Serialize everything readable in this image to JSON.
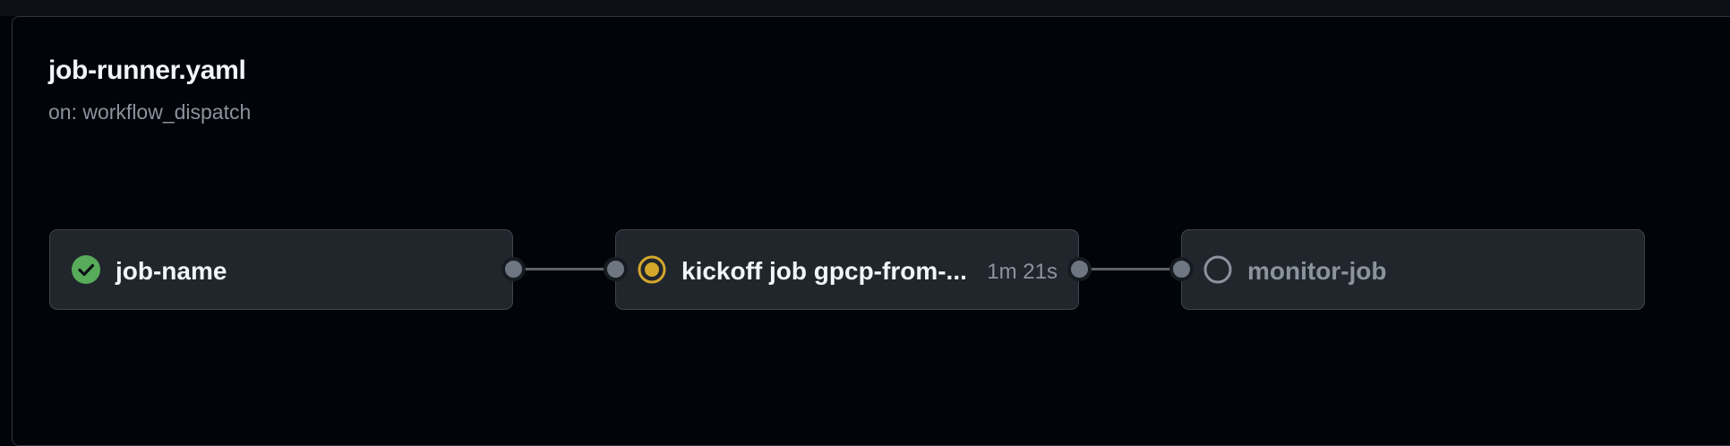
{
  "workflow": {
    "title": "job-runner.yaml",
    "trigger": "on: workflow_dispatch"
  },
  "jobs": [
    {
      "label": "job-name",
      "status": "success",
      "duration": ""
    },
    {
      "label": "kickoff job gpcp-from-...",
      "status": "in_progress",
      "duration": "1m 21s"
    },
    {
      "label": "monitor-job",
      "status": "queued",
      "duration": ""
    }
  ],
  "colors": {
    "success": "#57ab5a",
    "in_progress": "#d4a72c",
    "queued": "#8b949e"
  }
}
